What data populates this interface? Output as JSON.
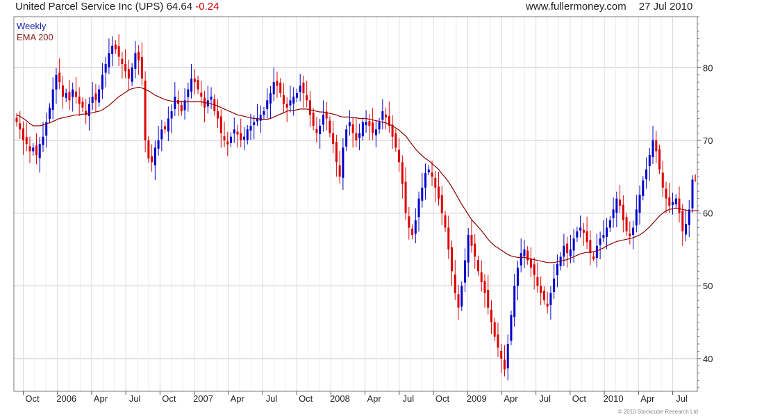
{
  "header": {
    "security": "United Parcel Service Inc (UPS)",
    "last": "64.64",
    "change": "-0.24",
    "site": "www.fullermoney.com",
    "date": "27 Jul 2010"
  },
  "copyright": "© 2010 Stockcube Research Ltd",
  "colors": {
    "up": "#0000cc",
    "down": "#dd0000",
    "ema": "#8b0000",
    "grid": "#d8d8d8"
  },
  "chart_data": {
    "type": "candlestick",
    "frequency": "weekly",
    "legend": [
      {
        "label": "Weekly",
        "color": "#1a1aa6"
      },
      {
        "label": "EMA 200",
        "color": "#8b2020"
      }
    ],
    "x_ticks": [
      "Oct",
      "2006",
      "Apr",
      "Jul",
      "Oct",
      "2007",
      "Apr",
      "Jul",
      "Oct",
      "2008",
      "Apr",
      "Jul",
      "Oct",
      "2009",
      "Apr",
      "Jul",
      "Oct",
      "2010",
      "Apr",
      "Jul"
    ],
    "ylim": [
      35.5,
      87
    ],
    "y_ticks": [
      40,
      50,
      60,
      70,
      80
    ],
    "close_series": [
      72.5,
      71.5,
      70.0,
      69.5,
      68.5,
      69.0,
      68.0,
      69.5,
      70.5,
      72.5,
      74.5,
      77.0,
      79.0,
      78.0,
      76.0,
      76.5,
      75.5,
      77.0,
      76.0,
      75.0,
      74.5,
      73.5,
      75.0,
      76.0,
      75.5,
      77.0,
      79.0,
      80.5,
      82.0,
      83.0,
      82.5,
      81.5,
      80.5,
      79.5,
      78.5,
      80.0,
      82.0,
      81.0,
      78.5,
      70.0,
      67.5,
      67.0,
      69.0,
      70.0,
      71.5,
      71.5,
      73.0,
      74.0,
      76.0,
      75.0,
      74.0,
      75.5,
      77.0,
      78.5,
      78.0,
      77.0,
      76.0,
      74.5,
      75.5,
      76.0,
      74.0,
      73.0,
      71.0,
      70.0,
      69.5,
      70.5,
      71.5,
      71.0,
      70.0,
      70.5,
      71.5,
      72.0,
      72.5,
      73.0,
      73.5,
      74.0,
      75.5,
      76.5,
      78.0,
      77.5,
      76.5,
      75.0,
      74.5,
      75.5,
      76.0,
      76.5,
      77.5,
      76.5,
      75.5,
      73.5,
      72.0,
      71.0,
      72.0,
      73.5,
      73.0,
      71.0,
      69.5,
      67.0,
      65.0,
      69.0,
      71.5,
      72.5,
      71.0,
      70.0,
      71.0,
      72.5,
      72.5,
      72.0,
      71.0,
      71.5,
      72.5,
      74.0,
      73.5,
      72.0,
      70.5,
      69.0,
      67.0,
      64.0,
      60.0,
      58.0,
      57.0,
      59.0,
      62.0,
      63.5,
      65.5,
      66.0,
      65.0,
      63.5,
      62.0,
      60.0,
      58.0,
      55.0,
      52.0,
      49.0,
      47.0,
      50.0,
      53.5,
      57.0,
      55.5,
      54.0,
      52.0,
      50.5,
      49.0,
      47.0,
      45.0,
      43.0,
      41.5,
      40.0,
      38.5,
      42.0,
      46.0,
      50.0,
      52.5,
      54.5,
      55.0,
      53.5,
      52.5,
      51.5,
      50.0,
      49.0,
      48.0,
      47.5,
      49.0,
      51.0,
      53.0,
      54.0,
      55.5,
      54.5,
      55.0,
      56.5,
      57.5,
      58.0,
      57.5,
      56.0,
      54.5,
      54.0,
      55.5,
      56.5,
      57.0,
      58.0,
      59.0,
      60.5,
      62.0,
      61.0,
      59.0,
      57.5,
      57.0,
      58.0,
      60.5,
      62.5,
      64.5,
      66.0,
      68.0,
      70.0,
      68.5,
      66.0,
      63.5,
      62.0,
      61.0,
      61.5,
      62.0,
      60.0,
      57.5,
      58.5,
      60.5,
      64.6
    ],
    "ema200_series": [
      73.5,
      73.3,
      73.0,
      72.7,
      72.3,
      72.0,
      72.0,
      72.0,
      72.1,
      72.3,
      72.4,
      72.6,
      72.8,
      73.0,
      73.1,
      73.2,
      73.3,
      73.4,
      73.5,
      73.5,
      73.6,
      73.6,
      73.7,
      73.8,
      73.9,
      74.0,
      74.2,
      74.5,
      74.8,
      75.2,
      75.6,
      76.0,
      76.3,
      76.6,
      76.9,
      77.1,
      77.2,
      77.3,
      77.2,
      77.0,
      76.8,
      76.5,
      76.2,
      76.0,
      75.8,
      75.6,
      75.5,
      75.4,
      75.3,
      75.3,
      75.3,
      75.3,
      75.3,
      75.3,
      75.3,
      75.3,
      75.3,
      75.2,
      75.1,
      75.0,
      74.9,
      74.7,
      74.5,
      74.3,
      74.1,
      73.9,
      73.7,
      73.5,
      73.4,
      73.3,
      73.2,
      73.1,
      73.0,
      73.0,
      72.9,
      72.9,
      72.9,
      73.0,
      73.2,
      73.4,
      73.6,
      73.8,
      74.0,
      74.1,
      74.1,
      74.2,
      74.3,
      74.3,
      74.3,
      74.2,
      74.1,
      74.0,
      73.9,
      73.9,
      73.8,
      73.7,
      73.6,
      73.5,
      73.3,
      73.2,
      73.2,
      73.2,
      73.1,
      73.1,
      73.0,
      73.0,
      73.0,
      72.9,
      72.8,
      72.7,
      72.6,
      72.5,
      72.4,
      72.2,
      72.0,
      71.7,
      71.4,
      71.0,
      70.6,
      70.0,
      69.4,
      68.8,
      68.3,
      67.9,
      67.5,
      67.2,
      66.8,
      66.4,
      66.0,
      65.4,
      64.9,
      64.3,
      63.6,
      62.8,
      62.0,
      61.2,
      60.5,
      59.8,
      59.1,
      58.6,
      58.1,
      57.6,
      57.0,
      56.4,
      55.9,
      55.5,
      55.2,
      54.9,
      54.6,
      54.3,
      54.1,
      54.0,
      53.9,
      53.9,
      53.9,
      53.8,
      53.7,
      53.6,
      53.5,
      53.4,
      53.3,
      53.2,
      53.2,
      53.2,
      53.3,
      53.4,
      53.5,
      53.6,
      53.8,
      54.0,
      54.2,
      54.4,
      54.5,
      54.6,
      54.6,
      54.7,
      54.8,
      55.0,
      55.2,
      55.5,
      55.7,
      55.9,
      56.1,
      56.2,
      56.3,
      56.4,
      56.5,
      56.6,
      56.8,
      57.0,
      57.3,
      57.7,
      58.1,
      58.6,
      59.1,
      59.6,
      60.0,
      60.3,
      60.5,
      60.6,
      60.6,
      60.6,
      60.5,
      60.4,
      60.3,
      60.3,
      60.3,
      60.3
    ]
  }
}
